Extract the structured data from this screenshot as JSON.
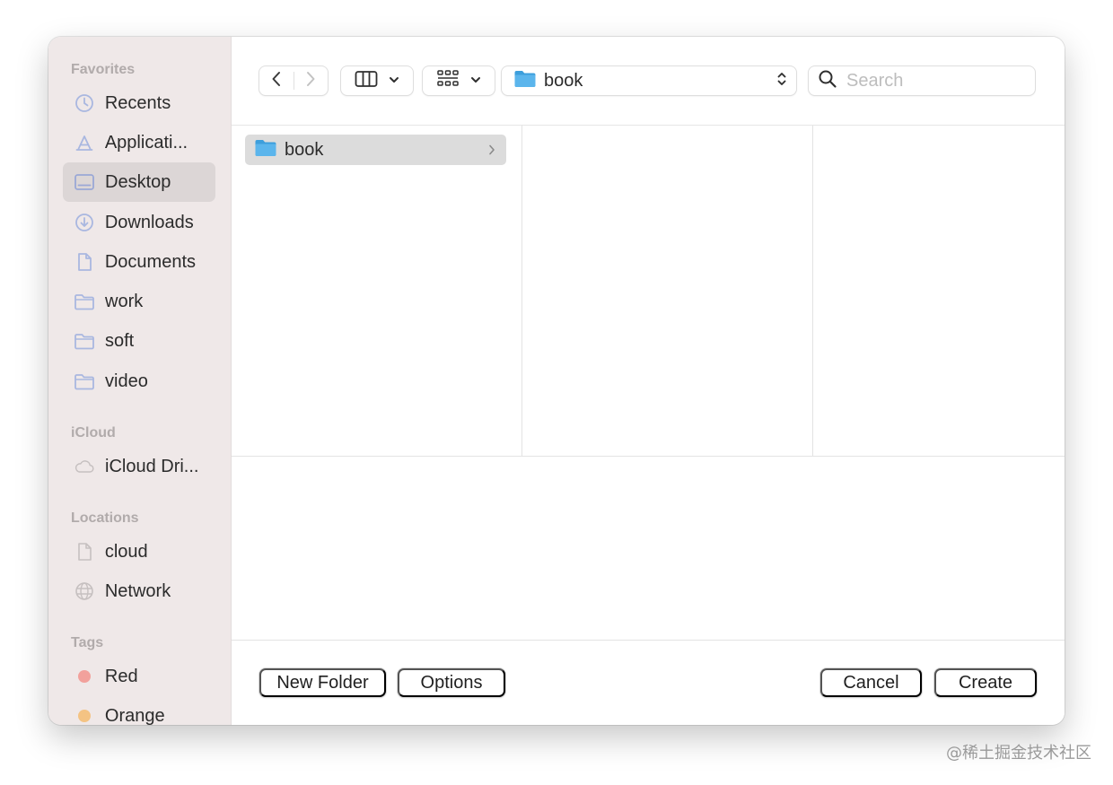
{
  "sidebar": {
    "favorites_title": "Favorites",
    "favorites": [
      {
        "label": "Recents",
        "icon": "clock-icon"
      },
      {
        "label": "Applicati...",
        "icon": "applications-icon"
      },
      {
        "label": "Desktop",
        "icon": "desktop-icon",
        "selected": true
      },
      {
        "label": "Downloads",
        "icon": "download-icon"
      },
      {
        "label": "Documents",
        "icon": "document-icon"
      },
      {
        "label": "work",
        "icon": "folder-icon"
      },
      {
        "label": "soft",
        "icon": "folder-icon"
      },
      {
        "label": "video",
        "icon": "folder-icon"
      }
    ],
    "icloud_title": "iCloud",
    "icloud": [
      {
        "label": "iCloud Dri...",
        "icon": "cloud-icon"
      }
    ],
    "locations_title": "Locations",
    "locations": [
      {
        "label": "cloud",
        "icon": "document-icon"
      },
      {
        "label": "Network",
        "icon": "globe-icon"
      }
    ],
    "tags_title": "Tags",
    "tags": [
      {
        "label": "Red",
        "color": "#f2a19c"
      },
      {
        "label": "Orange",
        "color": "#f4c383"
      }
    ]
  },
  "toolbar": {
    "path_label": "book",
    "search_placeholder": "Search"
  },
  "browser": {
    "column1": [
      {
        "label": "book",
        "icon": "folder-icon",
        "selected": true
      }
    ]
  },
  "footer": {
    "new_folder": "New Folder",
    "options": "Options",
    "cancel": "Cancel",
    "create": "Create"
  },
  "watermark": "@稀土掘金技术社区",
  "colors": {
    "sidebar_bg": "#efe8e8",
    "sidebar_icon": "#a9b7e0",
    "folder_blue": "#5bb5ec"
  }
}
